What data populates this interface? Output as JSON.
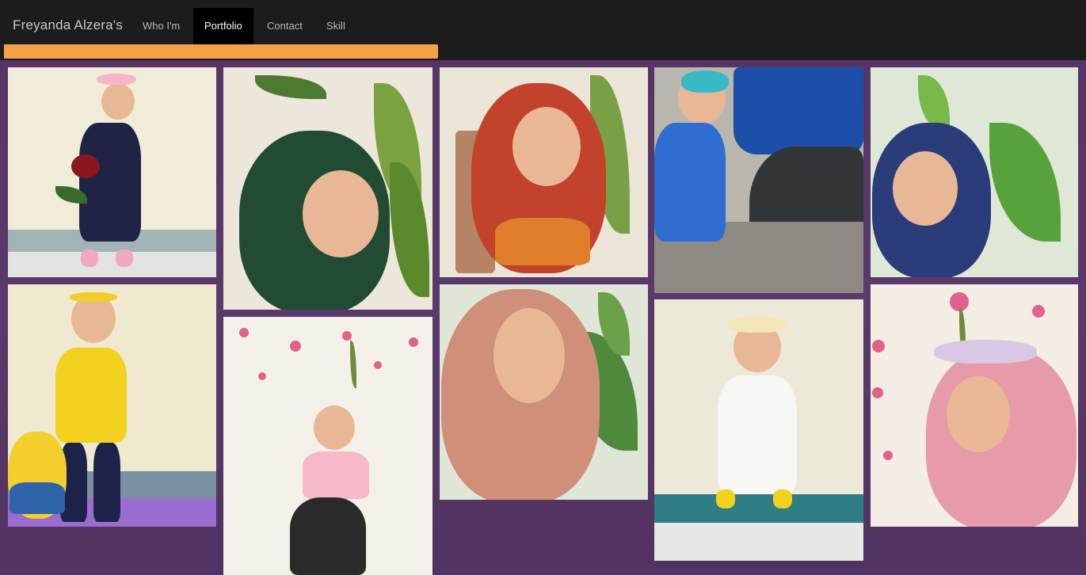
{
  "nav": {
    "brand": "Freyanda Alzera's",
    "items": [
      {
        "label": "Who I'm",
        "active": false
      },
      {
        "label": "Portfolio",
        "active": true
      },
      {
        "label": "Contact",
        "active": false
      },
      {
        "label": "Skill",
        "active": false
      }
    ],
    "scroll_progress": 0.4,
    "progress_color": "#f4a245"
  },
  "colors": {
    "navbar": "#1c1c1c",
    "background": "#553465",
    "active_nav": "#000000"
  },
  "gallery": {
    "columns": 5,
    "photos": [
      {
        "name": "photo-baby-bunny-ears-roses"
      },
      {
        "name": "photo-baby-green-hijab"
      },
      {
        "name": "photo-baby-striped-hijab"
      },
      {
        "name": "photo-baby-motorcycle"
      },
      {
        "name": "photo-baby-floral-hijab"
      },
      {
        "name": "photo-baby-yellow-jersey"
      },
      {
        "name": "photo-baby-pink-shirt-flowers"
      },
      {
        "name": "photo-baby-peach-hijab"
      },
      {
        "name": "photo-baby-white-outfit"
      },
      {
        "name": "photo-baby-pink-hijab-flowers"
      }
    ]
  }
}
